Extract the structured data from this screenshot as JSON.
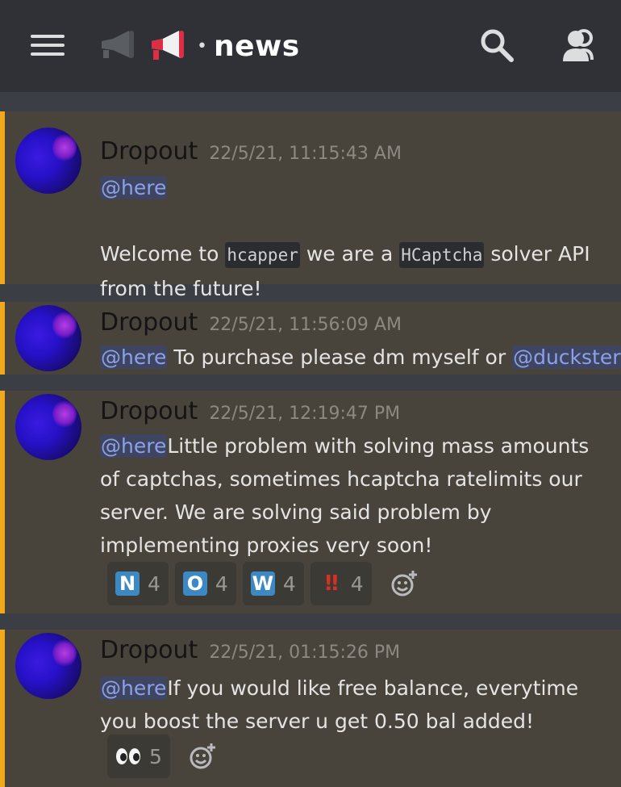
{
  "header": {
    "channel_name": "news",
    "separator": "•",
    "icons": [
      "hamburger-menu-icon",
      "megaphone-icon",
      "search-icon",
      "members-icon"
    ]
  },
  "messages": [
    {
      "author": "Dropout",
      "timestamp": "22/5/21, 11:15:43 AM",
      "mention": "@here",
      "line_welcome": "Welcome to ",
      "code1": "hcapper",
      "line_mid": " we are a ",
      "code2": "HCaptcha",
      "line_end": " solver API from the future!"
    },
    {
      "author": "Dropout",
      "timestamp": "22/5/21, 11:56:09 AM",
      "mention": "@here",
      "text": " To purchase please dm myself or ",
      "mention2": "@duckster"
    },
    {
      "author": "Dropout",
      "timestamp": "22/5/21, 12:19:47 PM",
      "mention": "@here",
      "text": "Little problem with solving mass amounts of captchas, sometimes hcaptcha ratelimits our server. We are solving said problem by implementing proxies very soon!",
      "reactions": [
        {
          "emoji": "N",
          "count": "4"
        },
        {
          "emoji": "O",
          "count": "4"
        },
        {
          "emoji": "W",
          "count": "4"
        },
        {
          "emoji": "‼",
          "count": "4"
        }
      ]
    },
    {
      "author": "Dropout",
      "timestamp": "22/5/21, 01:15:26 PM",
      "mention": "@here",
      "text": "If you would like free balance, everytime you boost the server u get 0.50 bal added!",
      "reactions": [
        {
          "emoji": "eyes",
          "count": "5"
        }
      ]
    }
  ],
  "colors": {
    "accent_highlight": "#f0a91d",
    "mention_text": "#8da0e8",
    "message_bg": "#49443b",
    "topbar_bg": "#2f3136"
  }
}
